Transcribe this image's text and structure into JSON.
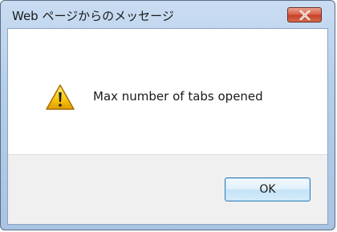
{
  "window": {
    "title": "Web ページからのメッセージ"
  },
  "titlebar": {
    "close_icon": "close-icon"
  },
  "message": {
    "icon": "warning-icon",
    "text": "Max number of tabs opened"
  },
  "buttons": {
    "ok_label": "OK"
  },
  "colors": {
    "titlebar": "#b5cde9",
    "close_button": "#d9634a",
    "ok_button_border": "#3c7fb1",
    "warning_yellow": "#f6c60e"
  }
}
